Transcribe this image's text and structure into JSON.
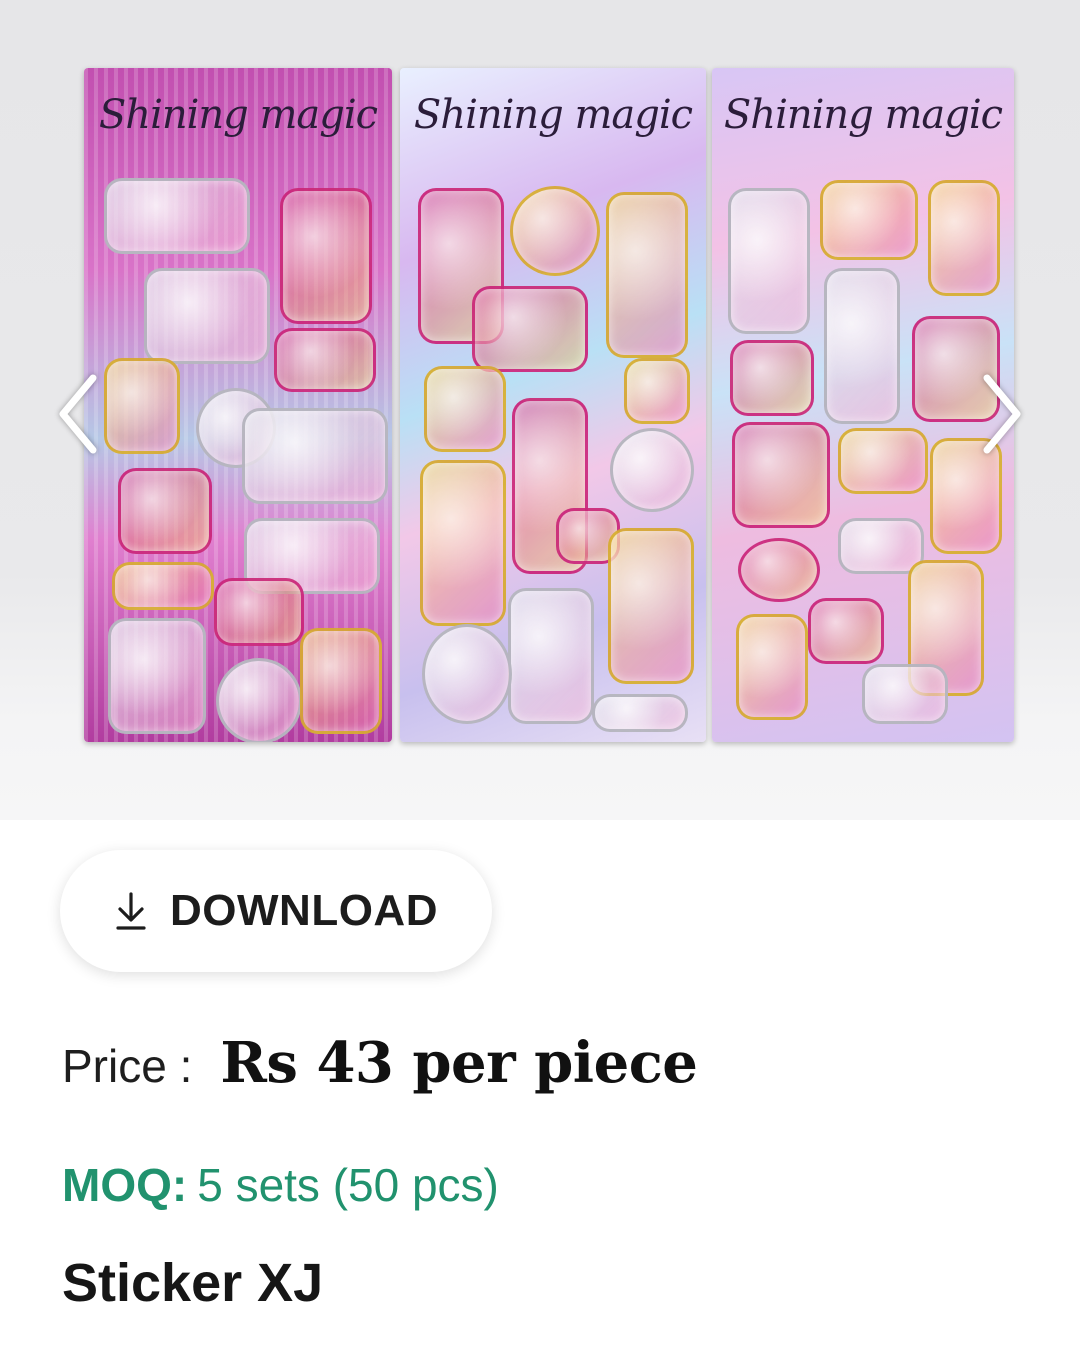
{
  "gallery": {
    "sheets": [
      {
        "header": "Shining magic"
      },
      {
        "header": "Shining magic"
      },
      {
        "header": "Shining magic"
      }
    ],
    "prev_icon": "chevron-left-icon",
    "next_icon": "chevron-right-icon"
  },
  "download": {
    "label": "DOWNLOAD",
    "icon": "download-arrow-icon"
  },
  "product": {
    "price_label": "Price :",
    "price_value": "Rs 43 per piece",
    "moq_label": "MOQ:",
    "moq_value": "5 sets (50 pcs)",
    "name": "Sticker XJ"
  },
  "colors": {
    "moq_green": "#21926e",
    "text_dark": "#161616"
  }
}
